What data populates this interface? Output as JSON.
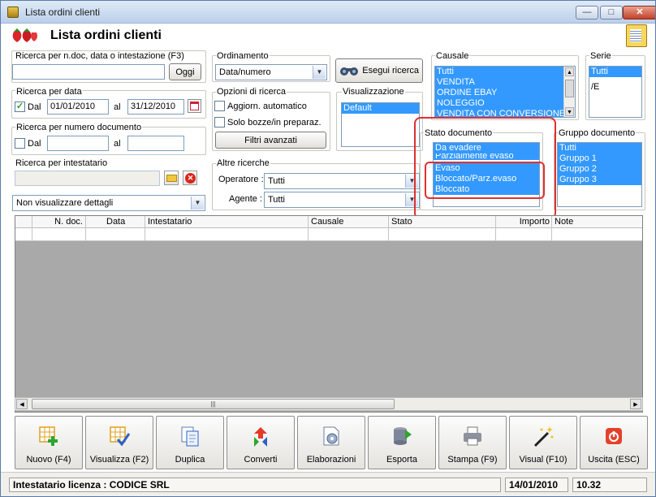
{
  "window": {
    "title": "Lista ordini clienti"
  },
  "header": {
    "title": "Lista ordini clienti"
  },
  "search": {
    "label": "Ricerca per n.doc, data o intestazione (F3)",
    "value": "",
    "today_button": "Oggi"
  },
  "date_search": {
    "label": "Ricerca per data",
    "from_label": "Dal",
    "from_checked": true,
    "from_value": "01/01/2010",
    "to_label": "al",
    "to_value": "31/12/2010"
  },
  "number_search": {
    "label": "Ricerca per numero documento",
    "from_label": "Dal",
    "from_checked": false,
    "from_value": "",
    "to_label": "al",
    "to_value": ""
  },
  "holder_search": {
    "label": "Ricerca per intestatario",
    "value": ""
  },
  "details_combo": {
    "value": "Non visualizzare dettagli"
  },
  "ordering": {
    "label": "Ordinamento",
    "value": "Data/numero"
  },
  "search_button": {
    "label": "Esegui ricerca"
  },
  "search_options": {
    "label": "Opzioni di ricerca",
    "auto_update": "Aggiorn. automatico",
    "auto_update_checked": false,
    "drafts_only": "Solo bozze/in preparaz.",
    "drafts_only_checked": false,
    "advanced_filters": "Filtri avanzati"
  },
  "display": {
    "label": "Visualizzazione",
    "items": [
      "Default"
    ]
  },
  "other_search": {
    "label": "Altre ricerche",
    "operator_label": "Operatore :",
    "operator_value": "Tutti",
    "agent_label": "Agente :",
    "agent_value": "Tutti"
  },
  "causale": {
    "label": "Causale",
    "items": [
      "Tutti",
      "VENDITA",
      "ORDINE EBAY",
      "NOLEGGIO",
      "VENDITA CON CONVERSIONE"
    ]
  },
  "serie": {
    "label": "Serie",
    "items": [
      "Tutti",
      "/E"
    ]
  },
  "doc_state": {
    "label": "Stato documento",
    "items": [
      "Da evadere",
      "Parzialmente evaso",
      "Evaso",
      "Bloccato/Parz.evaso",
      "Bloccato"
    ]
  },
  "doc_group": {
    "label": "Gruppo documento",
    "items": [
      "Tutti",
      "Gruppo 1",
      "Gruppo 2",
      "Gruppo 3"
    ]
  },
  "grid": {
    "columns": [
      "",
      "N. doc.",
      "Data",
      "Intestatario",
      "Causale",
      "Stato",
      "Importo",
      "Note"
    ]
  },
  "toolbar": {
    "new": "Nuovo (F4)",
    "view": "Visualizza (F2)",
    "duplicate": "Duplica",
    "convert": "Converti",
    "process": "Elaborazioni",
    "export": "Esporta",
    "print": "Stampa (F9)",
    "visual": "Visual (F10)",
    "exit": "Uscita (ESC)"
  },
  "status": {
    "license": "Intestatario licenza : CODICE SRL",
    "date": "14/01/2010",
    "time": "10.32"
  },
  "colors": {
    "selection": "#3399ff",
    "highlight": "#e03030"
  }
}
